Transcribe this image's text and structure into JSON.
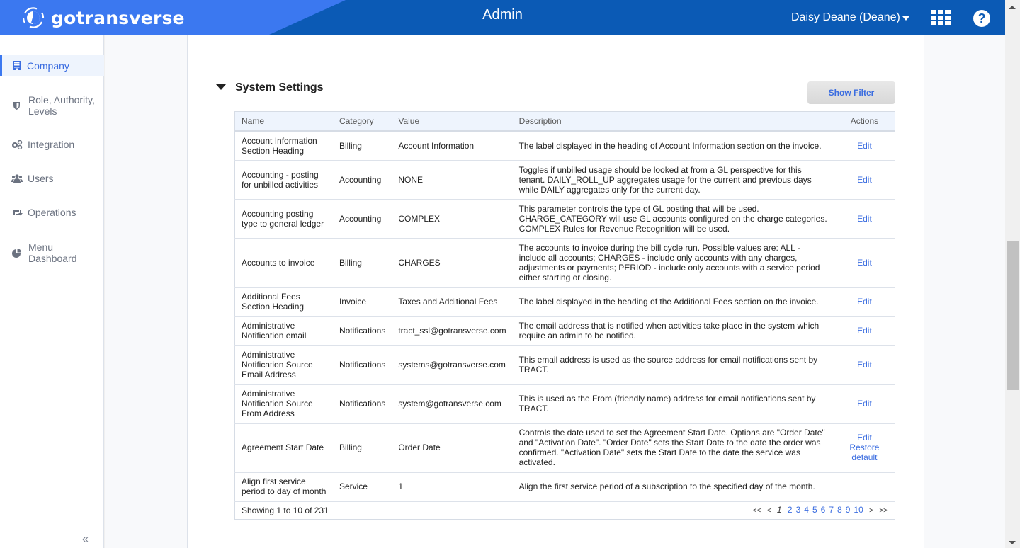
{
  "header": {
    "brand": "gotransverse",
    "title": "Admin",
    "user": "Daisy Deane (Deane)",
    "help_glyph": "?",
    "icons": {
      "logo": "gotransverse-logo-icon",
      "apps": "apps-grid-icon",
      "help": "help-icon",
      "user_caret": "caret-down-icon"
    }
  },
  "sidebar": {
    "items": [
      {
        "label": "Company",
        "icon": "building-icon",
        "active": true
      },
      {
        "label": "Role, Authority, Levels",
        "icon": "shield-icon",
        "active": false
      },
      {
        "label": "Integration",
        "icon": "gears-icon",
        "active": false
      },
      {
        "label": "Users",
        "icon": "users-icon",
        "active": false
      },
      {
        "label": "Operations",
        "icon": "retweet-icon",
        "active": false
      },
      {
        "label": "Menu Dashboard",
        "icon": "pie-chart-icon",
        "active": false
      }
    ],
    "collapse_glyph": "«"
  },
  "section": {
    "title": "System Settings",
    "filter_button": "Show Filter"
  },
  "table": {
    "columns": [
      "Name",
      "Category",
      "Value",
      "Description",
      "Actions"
    ],
    "rows": [
      {
        "name": "Account Information Section Heading",
        "category": "Billing",
        "value": "Account Information",
        "description": "The label displayed in the heading of Account Information section on the invoice.",
        "actions": [
          "Edit"
        ]
      },
      {
        "name": "Accounting - posting for unbilled activities",
        "category": "Accounting",
        "value": "NONE",
        "description": "Toggles if unbilled usage should be looked at from a GL perspective for this tenant. DAILY_ROLL_UP aggregates usage for the current and previous days while DAILY aggregates only for the current day.",
        "actions": [
          "Edit"
        ]
      },
      {
        "name": "Accounting posting type to general ledger",
        "category": "Accounting",
        "value": "COMPLEX",
        "description": "This parameter controls the type of GL posting that will be used. CHARGE_CATEGORY will use GL accounts configured on the charge categories. COMPLEX Rules for Revenue Recognition will be used.",
        "actions": [
          "Edit"
        ]
      },
      {
        "name": "Accounts to invoice",
        "category": "Billing",
        "value": "CHARGES",
        "description": "The accounts to invoice during the bill cycle run. Possible values are: ALL - include all accounts; CHARGES - include only accounts with any charges, adjustments or payments; PERIOD - include only accounts with a service period either starting or closing.",
        "actions": [
          "Edit"
        ]
      },
      {
        "name": "Additional Fees Section Heading",
        "category": "Invoice",
        "value": "Taxes and Additional Fees",
        "description": "The label displayed in the heading of the Additional Fees section on the invoice.",
        "actions": [
          "Edit"
        ]
      },
      {
        "name": "Administrative Notification email",
        "category": "Notifications",
        "value": "tract_ssl@gotransverse.com",
        "description": "The email address that is notified when activities take place in the system which require an admin to be notified.",
        "actions": [
          "Edit"
        ]
      },
      {
        "name": "Administrative Notification Source Email Address",
        "category": "Notifications",
        "value": "systems@gotransverse.com",
        "description": "This email address is used as the source address for email notifications sent by TRACT.",
        "actions": [
          "Edit"
        ]
      },
      {
        "name": "Administrative Notification Source From Address",
        "category": "Notifications",
        "value": "system@gotransverse.com",
        "description": "This is used as the From (friendly name) address for email notifications sent by TRACT.",
        "actions": [
          "Edit"
        ]
      },
      {
        "name": "Agreement Start Date",
        "category": "Billing",
        "value": "Order Date",
        "description": "Controls the date used to set the Agreement Start Date. Options are \"Order Date\" and \"Activation Date\". \"Order Date\" sets the Start Date to the date the order was confirmed. \"Activation Date\" sets the Start Date to the date the service was activated.",
        "actions": [
          "Edit",
          "Restore default"
        ]
      },
      {
        "name": "Align first service period to day of month",
        "category": "Service",
        "value": "1",
        "description": "Align the first service period of a subscription to the specified day of the month.",
        "actions": []
      }
    ],
    "row_heights": [],
    "summary": "Showing 1 to 10 of 231",
    "pagination": {
      "first": "<<",
      "prev": "<",
      "current": "1",
      "pages": [
        "2",
        "3",
        "4",
        "5",
        "6",
        "7",
        "8",
        "9",
        "10"
      ],
      "next": ">",
      "last": ">>"
    }
  },
  "colors": {
    "header_dark": "#0b5ab5",
    "header_brand": "#3b78f0",
    "link": "#3b6de0",
    "active_nav_bg": "#eef4fd"
  }
}
